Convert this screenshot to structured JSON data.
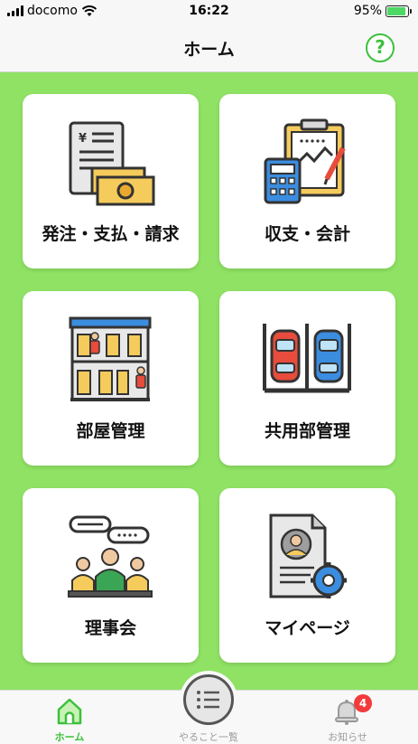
{
  "status_bar": {
    "carrier": "docomo",
    "time": "16:22",
    "battery": "95%",
    "battery_level": 0.95
  },
  "header": {
    "title": "ホーム",
    "help_label": "?"
  },
  "menu": {
    "items": [
      {
        "label": "発注・支払・請求",
        "icon": "invoice-money-icon"
      },
      {
        "label": "収支・会計",
        "icon": "accounting-clipboard-icon"
      },
      {
        "label": "部屋管理",
        "icon": "apartment-building-icon"
      },
      {
        "label": "共用部管理",
        "icon": "parking-cars-icon"
      },
      {
        "label": "理事会",
        "icon": "board-meeting-icon"
      },
      {
        "label": "マイページ",
        "icon": "profile-document-icon"
      }
    ]
  },
  "tabbar": {
    "home_label": "ホーム",
    "todo_label": "やること一覧",
    "notice_label": "お知らせ",
    "notice_badge": "4"
  },
  "colors": {
    "accent_green": "#3cc03c",
    "background_green": "#8fe264",
    "badge_red": "#f23b3b"
  }
}
